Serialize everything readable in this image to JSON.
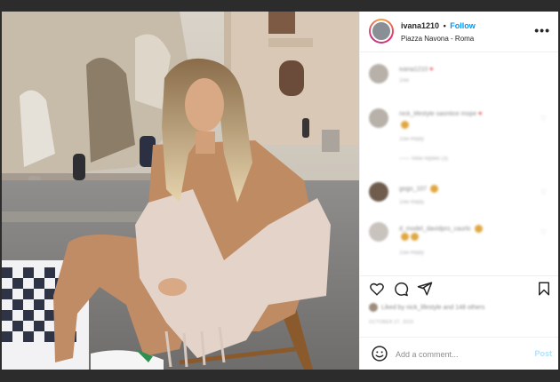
{
  "post": {
    "username": "ivana1210",
    "separator": "•",
    "follow_label": "Follow",
    "location": "Piazza Navona - Roma",
    "more_label": "•••"
  },
  "comments": [
    {
      "user_text": "ivana1210",
      "meta": "15w"
    },
    {
      "user_text": "nick_lifestyle saontice mope",
      "meta": "15w    Reply",
      "replies": "—— View replies (3)"
    },
    {
      "user_text": "gogo_107",
      "meta": "15w    Reply"
    },
    {
      "user_text": "d_model_davidpro_caurlo",
      "meta": "15w    Reply"
    }
  ],
  "likes_text": "Liked by nick_lifestyle and 148 others",
  "date_text": "OCTOBER 27, 2020",
  "add_comment": {
    "placeholder": "Add a comment...",
    "post_label": "Post"
  },
  "colors": {
    "accent": "#0095f6",
    "post_disabled": "#b2dffc",
    "heart": "#ed4956",
    "backdrop": "#2c2c2c"
  },
  "icons": [
    "heart-icon",
    "comment-icon",
    "share-icon",
    "bookmark-icon",
    "smile-icon",
    "more-icon"
  ]
}
